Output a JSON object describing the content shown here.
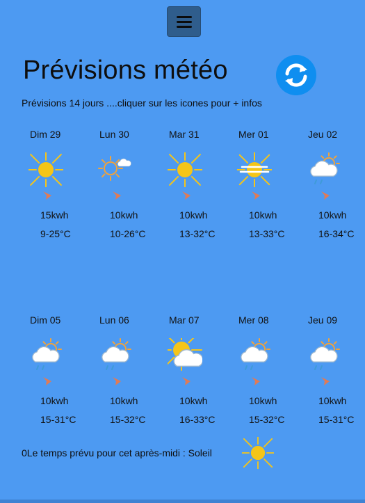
{
  "header": {
    "title": "Prévisions météo",
    "subtitle": "Prévisions 14 jours ....cliquer sur les icones pour + infos"
  },
  "week1": [
    {
      "day": "Dim 29",
      "icon": "sun",
      "energy": "15kwh",
      "temps": "9-25°C"
    },
    {
      "day": "Lun 30",
      "icon": "sun-small-cloud",
      "energy": "10kwh",
      "temps": "10-26°C"
    },
    {
      "day": "Mar 31",
      "icon": "sun",
      "energy": "10kwh",
      "temps": "13-32°C"
    },
    {
      "day": "Mer 01",
      "icon": "sun-haze",
      "energy": "10kwh",
      "temps": "13-33°C"
    },
    {
      "day": "Jeu 02",
      "icon": "cloud-sun-rain",
      "energy": "10kwh",
      "temps": "16-34°C"
    }
  ],
  "week2": [
    {
      "day": "Dim 05",
      "icon": "cloud-sun-rain",
      "energy": "10kwh",
      "temps": "15-31°C"
    },
    {
      "day": "Lun 06",
      "icon": "cloud-sun-rain",
      "energy": "10kwh",
      "temps": "15-32°C"
    },
    {
      "day": "Mar 07",
      "icon": "sun-behind-cloud",
      "energy": "10kwh",
      "temps": "16-33°C"
    },
    {
      "day": "Mer 08",
      "icon": "cloud-sun-rain",
      "energy": "10kwh",
      "temps": "15-32°C"
    },
    {
      "day": "Jeu 09",
      "icon": "cloud-sun-rain",
      "energy": "10kwh",
      "temps": "15-31°C"
    }
  ],
  "footer": {
    "text": "0Le temps prévu pour cet après-midi : Soleil",
    "icon": "sun"
  },
  "colors": {
    "background": "#4d9af2",
    "menu_button": "#2f5d8c",
    "refresh_button": "#0f8ef0",
    "sun": "#f5c518",
    "wind_arrow": "#e07b56"
  }
}
